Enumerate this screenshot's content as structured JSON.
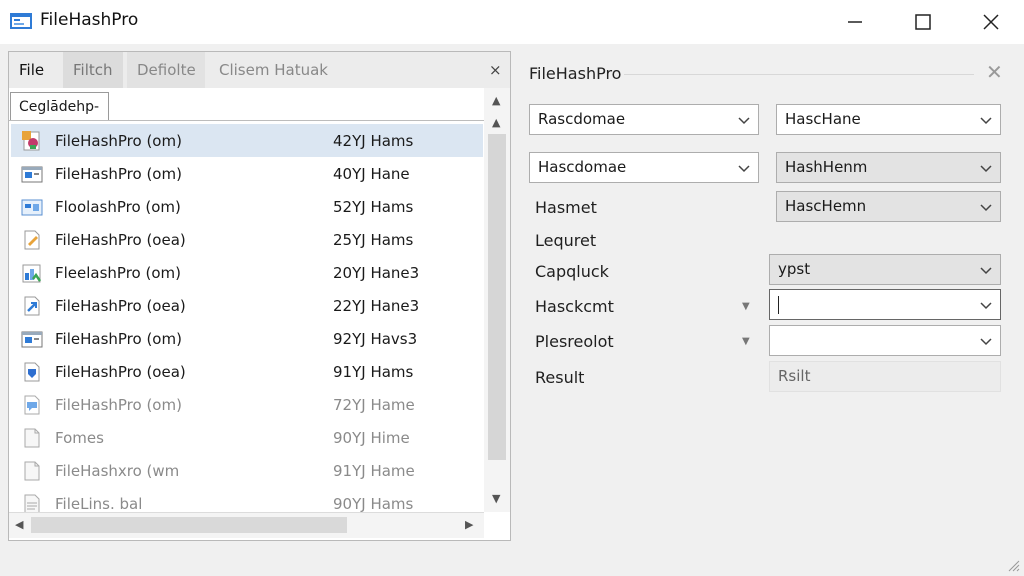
{
  "window": {
    "title": "FileHashPro",
    "minimize_icon": "minimize-icon",
    "maximize_icon": "maximize-icon",
    "close_icon": "close-icon"
  },
  "menu": {
    "items": [
      "File",
      "Filtch",
      "Defiolte",
      "Clisem Hatuak"
    ],
    "close_glyph": "×"
  },
  "tab": {
    "label": "Ceglādehp-"
  },
  "files": [
    {
      "name": "FileHashPro (om)",
      "size": "42YJ Hams",
      "icon": "image-file-icon",
      "selected": true,
      "dim": false
    },
    {
      "name": "FileHashPro (om)",
      "size": "40YJ Hane",
      "icon": "window-file-icon",
      "selected": false,
      "dim": false
    },
    {
      "name": "FloolashPro (om)",
      "size": "52YJ Hams",
      "icon": "app-file-icon",
      "selected": false,
      "dim": false
    },
    {
      "name": "FileHashPro (oea)",
      "size": "25YJ Hams",
      "icon": "edit-file-icon",
      "selected": false,
      "dim": false
    },
    {
      "name": "FleelashPro (om)",
      "size": "20YJ Hane3",
      "icon": "chart-file-icon",
      "selected": false,
      "dim": false
    },
    {
      "name": "FileHashPro (oea)",
      "size": "22YJ Hane3",
      "icon": "link-file-icon",
      "selected": false,
      "dim": false
    },
    {
      "name": "FileHashPro (om)",
      "size": "92YJ Havs3",
      "icon": "window-file-icon",
      "selected": false,
      "dim": false
    },
    {
      "name": "FileHashPro (oea)",
      "size": "91YJ Hams",
      "icon": "shield-file-icon",
      "selected": false,
      "dim": false
    },
    {
      "name": "FileHashPro (om)",
      "size": "72YJ Hame",
      "icon": "chat-file-icon",
      "selected": false,
      "dim": true
    },
    {
      "name": "Fomes",
      "size": "90YJ Hime",
      "icon": "blank-file-icon",
      "selected": false,
      "dim": true
    },
    {
      "name": "FileHashxro (wm",
      "size": "91YJ Hame",
      "icon": "blank-file-icon",
      "selected": false,
      "dim": true
    },
    {
      "name": "FileLins. bal",
      "size": "90YJ Hams",
      "icon": "text-file-icon",
      "selected": false,
      "dim": true
    }
  ],
  "panel": {
    "title": "FileHashPro",
    "close_glyph": "✕",
    "row1": {
      "left": "Rascdomae",
      "right": "HascHane"
    },
    "row2": {
      "left": "Hascdomae",
      "right": "HashHenm"
    },
    "hasmet": {
      "label": "Hasmet",
      "value": "HascHemn"
    },
    "lequret": {
      "label": "Lequret"
    },
    "capqluck": {
      "label": "Capqluck",
      "value": "ypst"
    },
    "hasckcmt": {
      "label": "Hasckcmt",
      "value": ""
    },
    "plesreolot": {
      "label": "Plesreolot",
      "value": ""
    },
    "result": {
      "label": "Result",
      "value": "Rsilt"
    }
  },
  "colors": {
    "selection": "#dbe6f2",
    "window_bg": "#f0f0f0",
    "border": "#adadad"
  }
}
